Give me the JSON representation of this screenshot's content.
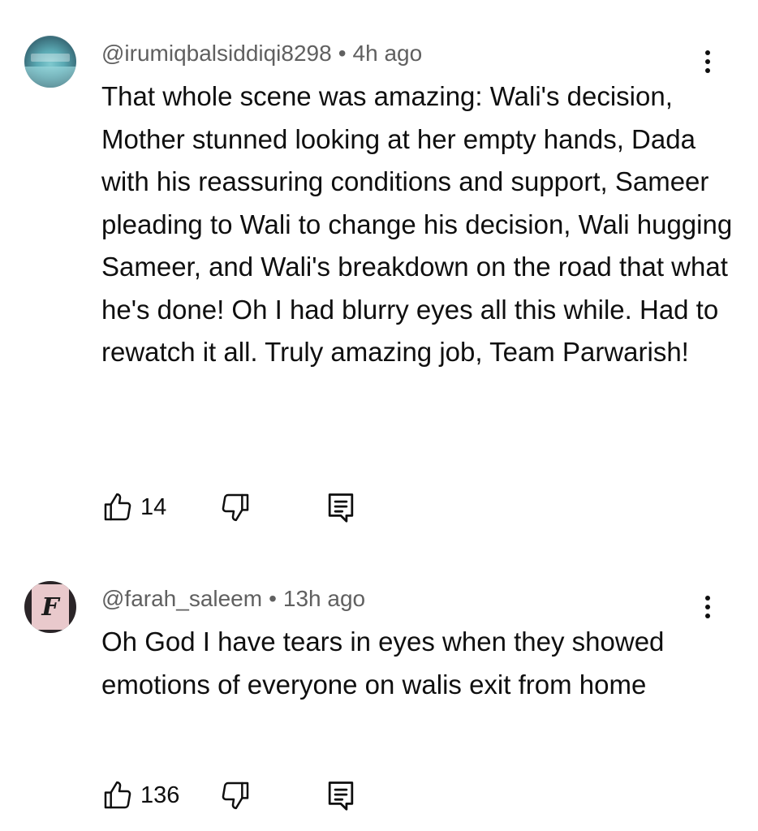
{
  "comments": [
    {
      "handle": "@irumiqbalsiddiqi8298",
      "separator": "•",
      "time": "4h ago",
      "text": "That whole scene was amazing: Wali's decision, Mother stunned looking at her empty hands, Dada with his reassuring conditions and support, Sameer pleading to Wali to change his decision, Wali hugging Sameer, and Wali's breakdown on the road that what he's done! Oh I had blurry eyes all this while. Had to rewatch it all. Truly amazing job, Team Parwarish!",
      "likes": "14"
    },
    {
      "handle": "@farah_saleem",
      "separator": "•",
      "time": "13h ago",
      "text": "Oh God I have tears in eyes when they showed emotions of everyone on walis exit from home",
      "likes": "136",
      "avatar_letter": "F"
    }
  ],
  "icons": {
    "like": "thumbs-up-icon",
    "dislike": "thumbs-down-icon",
    "reply": "reply-comment-icon",
    "more": "more-vertical-icon"
  },
  "colors": {
    "text": "#0f0f0f",
    "meta": "#606060",
    "background": "#ffffff"
  }
}
